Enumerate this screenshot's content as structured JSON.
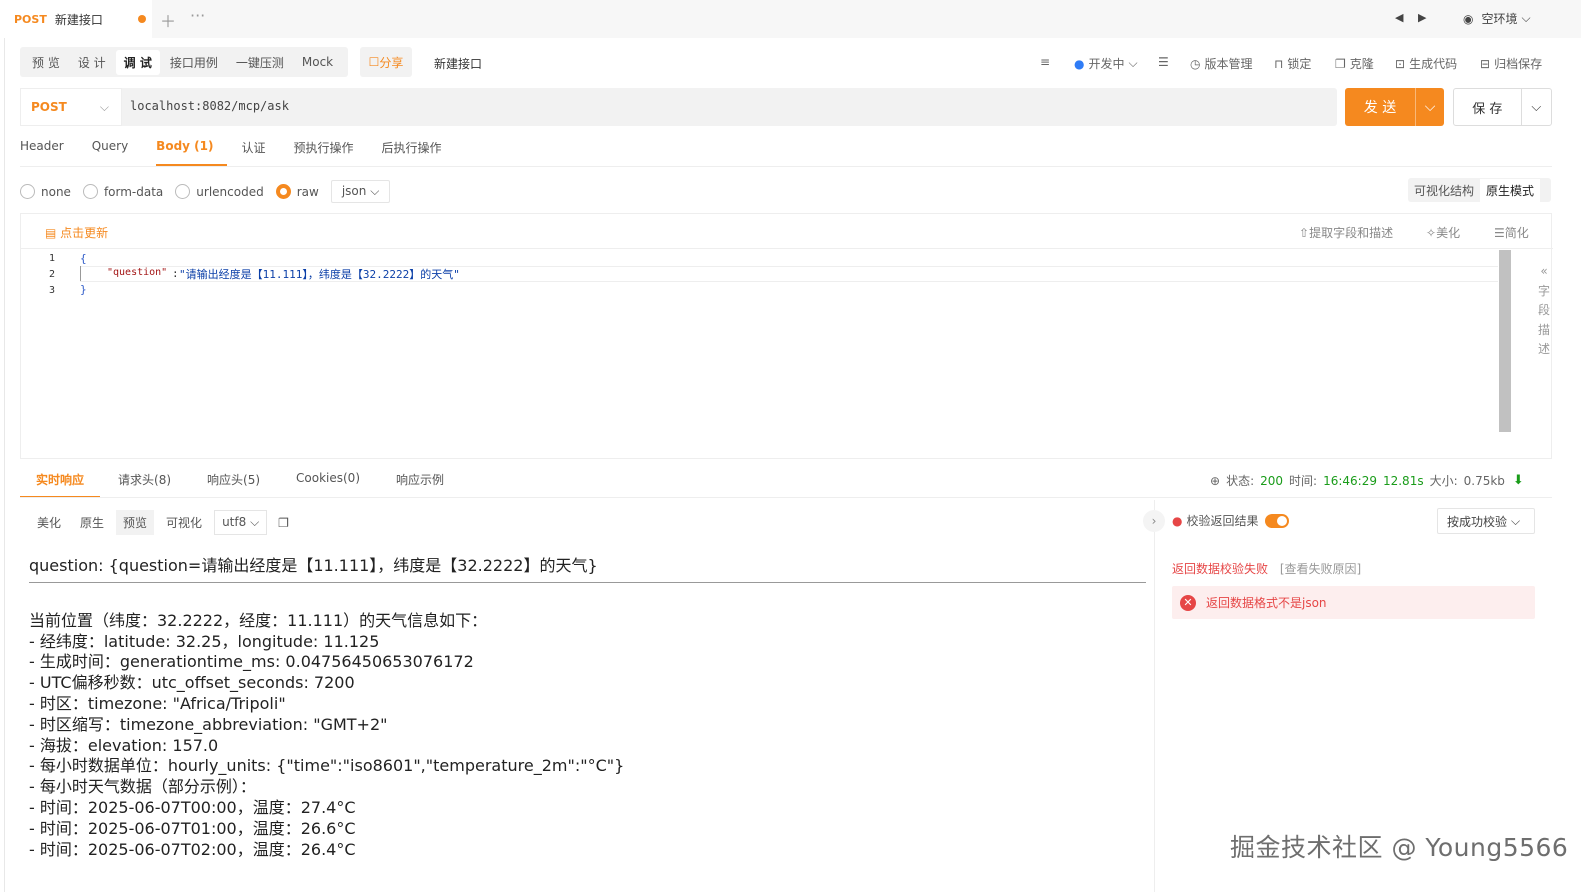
{
  "tabbar": {
    "method": "POST",
    "title": "新建接口",
    "env": "空环境"
  },
  "toolbar": {
    "modes": [
      "预 览",
      "设 计",
      "调 试",
      "接口用例",
      "一键压测",
      "Mock"
    ],
    "share": "分享",
    "interface_name": "新建接口",
    "right": [
      "开发中",
      "版本管理",
      "锁定",
      "克隆",
      "生成代码",
      "归档保存"
    ]
  },
  "request": {
    "method": "POST",
    "url": "localhost:8082/mcp/ask",
    "send": "发 送",
    "save": "保 存"
  },
  "req_tabs": [
    "Header",
    "Query",
    "Body (1)",
    "认证",
    "预执行操作",
    "后执行操作"
  ],
  "body_types": [
    "none",
    "form-data",
    "urlencoded",
    "raw"
  ],
  "format": "json",
  "view_modes": [
    "可视化结构",
    "原生模式"
  ],
  "editor": {
    "refresh": "点击更新",
    "extract": "提取字段和描述",
    "beautify": "美化",
    "simplify": "简化",
    "lines": [
      "1",
      "2",
      "3"
    ],
    "code_open": "{",
    "code_key": "\"question\"",
    "code_colon": ":",
    "code_val": "\"请输出经度是【11.111】，纬度是【32.2222】的天气\"",
    "code_close": "}",
    "side": [
      "字",
      "段",
      "描",
      "述"
    ]
  },
  "resp_tabs": [
    "实时响应",
    "请求头(8)",
    "响应头(5)",
    "Cookies(0)",
    "响应示例"
  ],
  "status": {
    "label": "状态:",
    "code": "200",
    "time_label": "时间:",
    "time": "16:46:29",
    "duration": "12.81s",
    "size_label": "大小:",
    "size": "0.75kb"
  },
  "resp_tools": [
    "美化",
    "原生",
    "预览",
    "可视化"
  ],
  "encoding": "utf8",
  "response": {
    "question": "question: {question=请输出经度是【11.111】，纬度是【32.2222】的天气}",
    "lines": [
      "当前位置（纬度：32.2222，经度：11.111）的天气信息如下：",
      "- 经纬度：latitude: 32.25，longitude: 11.125",
      "- 生成时间：generationtime_ms: 0.04756450653076172",
      "- UTC偏移秒数：utc_offset_seconds: 7200",
      "- 时区：timezone: \"Africa/Tripoli\"",
      "- 时区缩写：timezone_abbreviation: \"GMT+2\"",
      "- 海拔：elevation: 157.0",
      "- 每小时数据单位：hourly_units: {\"time\":\"iso8601\",\"temperature_2m\":\"°C\"}",
      "- 每小时天气数据（部分示例）：",
      "- 时间：2025-06-07T00:00，温度：27.4°C",
      "- 时间：2025-06-07T01:00，温度：26.6°C",
      "- 时间：2025-06-07T02:00，温度：26.4°C"
    ]
  },
  "validation": {
    "label": "校验返回结果",
    "mode": "按成功校验",
    "fail": "返回数据校验失败",
    "reason": "[查看失败原因]",
    "error": "返回数据格式不是json"
  },
  "watermark": "掘金技术社区 @ Young5566",
  "colors": {
    "accent": "#f5891f",
    "success": "#1a9c1a",
    "error": "#e64646"
  }
}
